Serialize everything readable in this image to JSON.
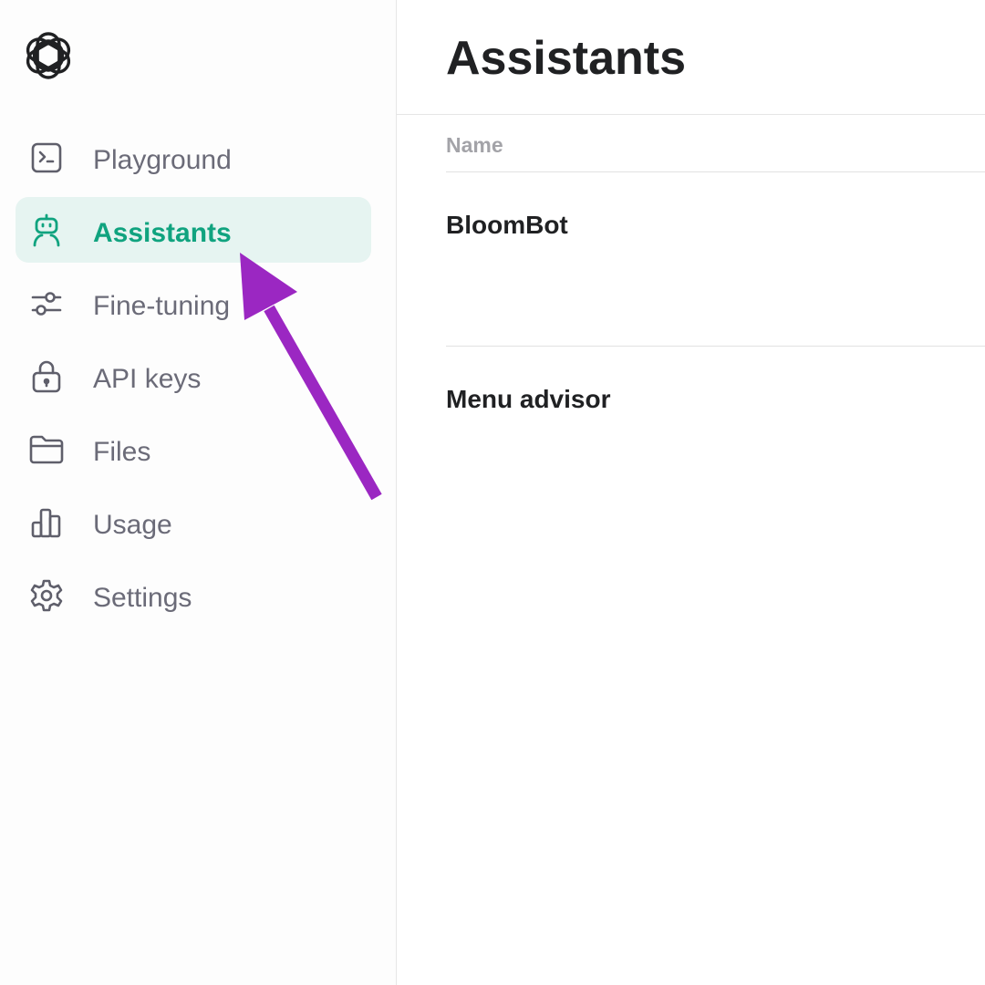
{
  "sidebar": {
    "logo_icon": "openai-logo-icon",
    "items": [
      {
        "label": "Playground",
        "icon": "terminal-icon",
        "active": false
      },
      {
        "label": "Assistants",
        "icon": "robot-icon",
        "active": true
      },
      {
        "label": "Fine-tuning",
        "icon": "sliders-icon",
        "active": false
      },
      {
        "label": "API keys",
        "icon": "lock-icon",
        "active": false
      },
      {
        "label": "Files",
        "icon": "folder-icon",
        "active": false
      },
      {
        "label": "Usage",
        "icon": "bar-chart-icon",
        "active": false
      },
      {
        "label": "Settings",
        "icon": "gear-icon",
        "active": false
      }
    ]
  },
  "main": {
    "title": "Assistants",
    "table": {
      "columns": [
        "Name"
      ],
      "rows": [
        {
          "name": "BloomBot"
        },
        {
          "name": "Menu advisor"
        }
      ]
    }
  },
  "colors": {
    "accent": "#10a37f",
    "active_background": "#e6f4f1",
    "annotation_arrow": "#9b27c2",
    "text_primary": "#202123",
    "text_secondary": "#6b6b78"
  }
}
